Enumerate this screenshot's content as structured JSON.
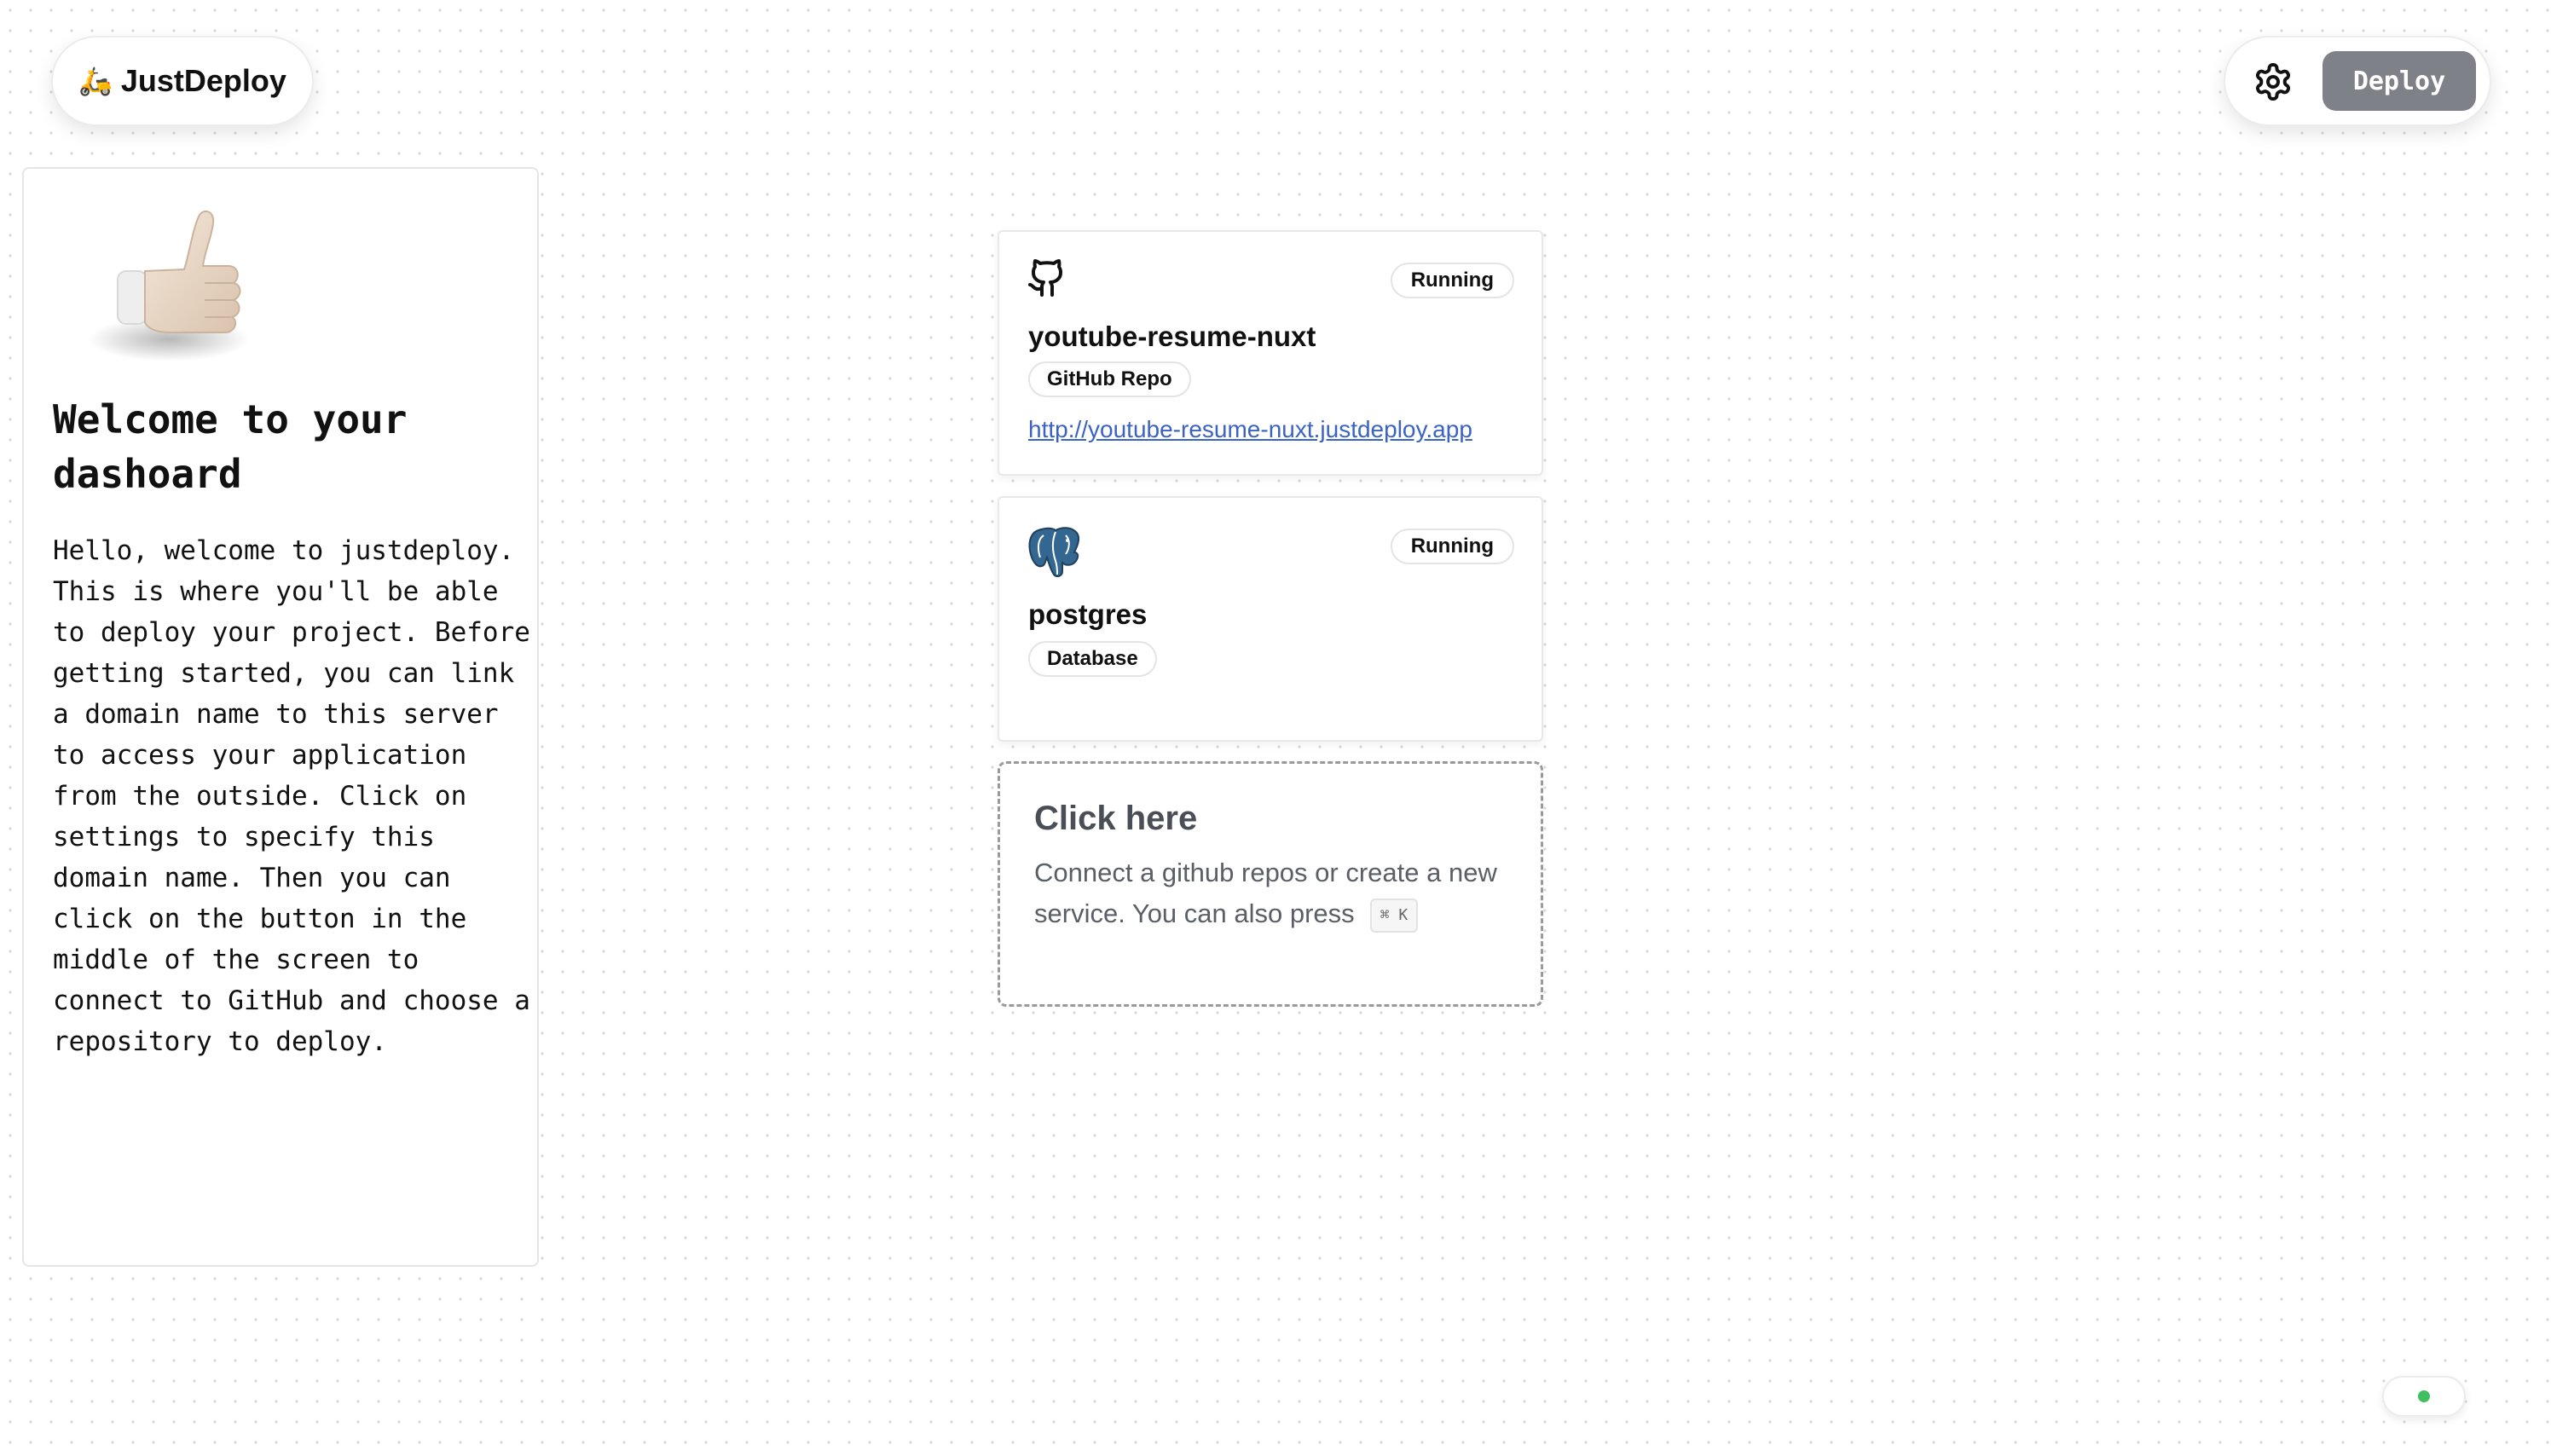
{
  "header": {
    "brand_emoji": "🛵",
    "brand_name": "JustDeploy",
    "settings_icon": "gear-icon",
    "deploy_label": "Deploy"
  },
  "welcome": {
    "illustration": "thumbs-up-hand",
    "title": "Welcome to your dashoard",
    "body": "Hello, welcome to justdeploy. This is where you'll be able to deploy your project. Before getting started, you can link a domain name to this server to access your application from the outside. Click on settings to specify this domain name. Then you can click on the button in the middle of the screen to connect to GitHub and choose a repository to deploy."
  },
  "services": [
    {
      "icon": "github-icon",
      "name": "youtube-resume-nuxt",
      "status": "Running",
      "type": "GitHub Repo",
      "url": "http://youtube-resume-nuxt.justdeploy.app"
    },
    {
      "icon": "postgres-icon",
      "name": "postgres",
      "status": "Running",
      "type": "Database"
    }
  ],
  "cta": {
    "title": "Click here",
    "description": "Connect a github repos or create a new service. You can also press",
    "shortcut": "⌘ K"
  },
  "colors": {
    "deploy_button": "#7f8188",
    "link": "#3b63c4",
    "connection_dot": "#3fbf5f"
  }
}
